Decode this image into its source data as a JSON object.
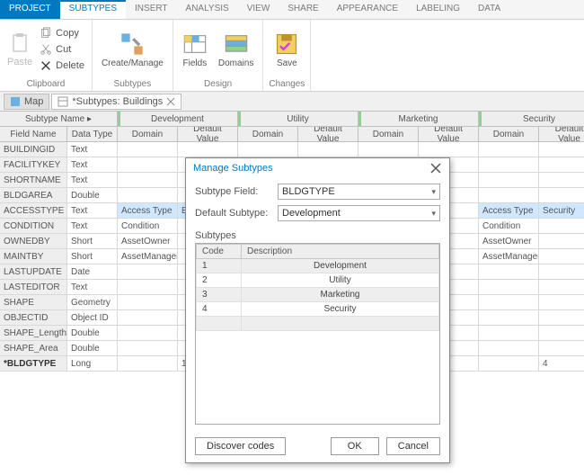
{
  "ribbon": {
    "tabs": [
      "PROJECT",
      "SUBTYPES",
      "INSERT",
      "ANALYSIS",
      "VIEW",
      "SHARE",
      "APPEARANCE",
      "LABELING",
      "DATA"
    ],
    "active_tab": "SUBTYPES",
    "clipboard": {
      "paste": "Paste",
      "copy": "Copy",
      "cut": "Cut",
      "delete": "Delete",
      "group": "Clipboard"
    },
    "subtypes": {
      "create_manage": "Create/Manage",
      "group": "Subtypes"
    },
    "design": {
      "fields": "Fields",
      "domains": "Domains",
      "group": "Design"
    },
    "changes": {
      "save": "Save",
      "group": "Changes"
    }
  },
  "doc_tabs": {
    "map": "Map",
    "subtypes": "*Subtypes: Buildings"
  },
  "grid": {
    "group_headers": {
      "subtype_name": "Subtype Name ▸",
      "dev": "Development",
      "util": "Utility",
      "mkt": "Marketing",
      "sec": "Security"
    },
    "col_headers": {
      "field": "Field Name",
      "type": "Data Type",
      "domain": "Domain",
      "default": "Default Value"
    },
    "rows": [
      {
        "name": "BUILDINGID",
        "type": "Text"
      },
      {
        "name": "FACILITYKEY",
        "type": "Text"
      },
      {
        "name": "SHORTNAME",
        "type": "Text"
      },
      {
        "name": "BLDGAREA",
        "type": "Double"
      },
      {
        "name": "ACCESSTYPE",
        "type": "Text",
        "dev_dom": "Access Type",
        "dev_def": "Employees",
        "sec_dom": "Access Type",
        "sec_def": "Security"
      },
      {
        "name": "CONDITION",
        "type": "Text",
        "dev_dom": "Condition",
        "sec_dom": "Condition"
      },
      {
        "name": "OWNEDBY",
        "type": "Short",
        "dev_dom": "AssetOwner",
        "sec_dom": "AssetOwner"
      },
      {
        "name": "MAINTBY",
        "type": "Short",
        "dev_dom": "AssetManager",
        "sec_dom": "AssetManager"
      },
      {
        "name": "LASTUPDATE",
        "type": "Date"
      },
      {
        "name": "LASTEDITOR",
        "type": "Text"
      },
      {
        "name": "SHAPE",
        "type": "Geometry"
      },
      {
        "name": "OBJECTID",
        "type": "Object ID"
      },
      {
        "name": "SHAPE_Length",
        "type": "Double"
      },
      {
        "name": "SHAPE_Area",
        "type": "Double"
      },
      {
        "name": "*BLDGTYPE",
        "type": "Long",
        "dev_def": "1",
        "sec_def": "4",
        "bold": true
      }
    ]
  },
  "dialog": {
    "title": "Manage Subtypes",
    "field_label": "Subtype Field:",
    "field_value": "BLDGTYPE",
    "default_label": "Default Subtype:",
    "default_value": "Development",
    "subtypes_label": "Subtypes",
    "th_code": "Code",
    "th_desc": "Description",
    "rows": [
      {
        "code": "1",
        "desc": "Development"
      },
      {
        "code": "2",
        "desc": "Utility"
      },
      {
        "code": "3",
        "desc": "Marketing"
      },
      {
        "code": "4",
        "desc": "Security"
      }
    ],
    "discover": "Discover codes",
    "ok": "OK",
    "cancel": "Cancel"
  }
}
